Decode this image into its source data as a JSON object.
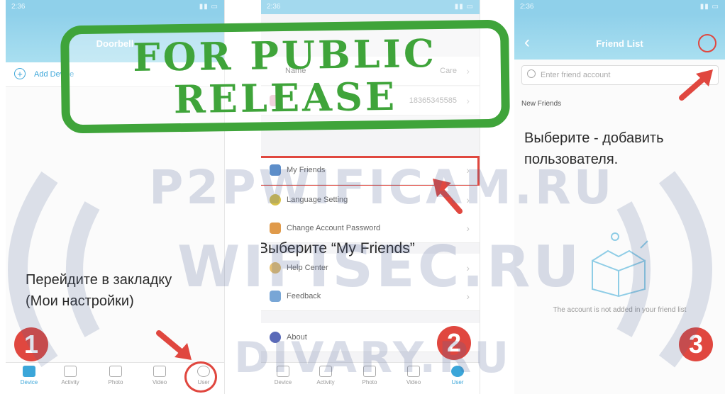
{
  "stamp": {
    "line1": "FOR PUBLIC",
    "line2": "RELEASE"
  },
  "watermarks": [
    "P2PWIFICAM.RU",
    "WIFISEC.RU",
    "DIVARY.RU"
  ],
  "phone1": {
    "time": "2:36",
    "title": "Doorbell",
    "add_device": "Add Device",
    "caption": [
      "Перейдите в закладку",
      "(Мои настройки)"
    ],
    "step": "1",
    "tabs": [
      "Device",
      "Activity",
      "Photo",
      "Video",
      "User"
    ]
  },
  "phone2": {
    "time": "2:36",
    "rows": {
      "name_label": "Name",
      "name_value": "Care",
      "phone_value": "18365345585",
      "my_friends": "My Friends",
      "language": "Language Setting",
      "password": "Change Account Password",
      "help": "Help Center",
      "feedback": "Feedback",
      "about": "About"
    },
    "caption": "Выберите “My Friends”",
    "step": "2",
    "tabs": [
      "Device",
      "Activity",
      "Photo",
      "Video",
      "User"
    ]
  },
  "phone3": {
    "time": "2:36",
    "title": "Friend List",
    "search_placeholder": "Enter friend account",
    "new_friends": "New Friends",
    "caption": [
      "Выберите - добавить",
      "пользователя."
    ],
    "empty_text": "The account is not added in your friend list",
    "step": "3"
  },
  "colors": {
    "accent": "#3ba6d9",
    "header": "#8fd0ea",
    "highlight": "#e0473f",
    "stamp": "#3fa43a"
  }
}
